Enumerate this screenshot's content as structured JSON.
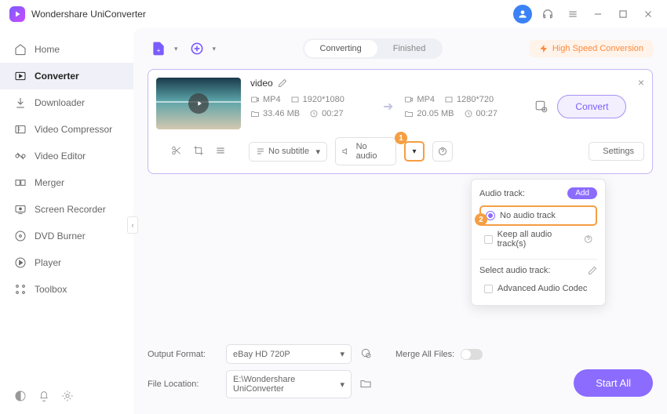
{
  "app_title": "Wondershare UniConverter",
  "sidebar": {
    "items": [
      "Home",
      "Converter",
      "Downloader",
      "Video Compressor",
      "Video Editor",
      "Merger",
      "Screen Recorder",
      "DVD Burner",
      "Player",
      "Toolbox"
    ]
  },
  "tabs": {
    "converting": "Converting",
    "finished": "Finished"
  },
  "highspeed": "High Speed Conversion",
  "video": {
    "title": "video",
    "src": {
      "fmt": "MP4",
      "res": "1920*1080",
      "size": "33.46 MB",
      "dur": "00:27"
    },
    "dst": {
      "fmt": "MP4",
      "res": "1280*720",
      "size": "20.05 MB",
      "dur": "00:27"
    }
  },
  "convert_btn": "Convert",
  "subtitle_dd": "No subtitle",
  "audio_dd": "No audio",
  "settings_btn": "Settings",
  "popup": {
    "header": "Audio track:",
    "add": "Add",
    "opt1": "No audio track",
    "opt2": "Keep all audio track(s)",
    "sub_header": "Select audio track:",
    "opt3": "Advanced Audio Codec"
  },
  "bottom": {
    "output_lbl": "Output Format:",
    "output_val": "eBay HD 720P",
    "file_lbl": "File Location:",
    "file_val": "E:\\Wondershare UniConverter",
    "merge_lbl": "Merge All Files:"
  },
  "startall": "Start All"
}
